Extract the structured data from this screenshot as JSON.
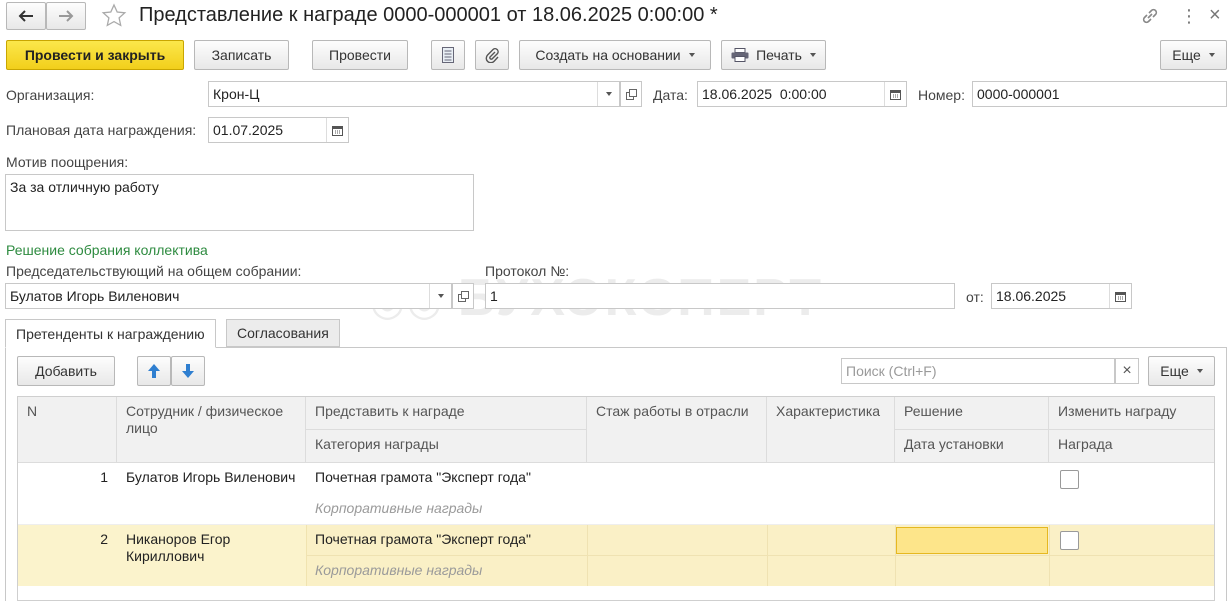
{
  "window": {
    "title": "Представление к награде 0000-000001 от 18.06.2025 0:00:00 *"
  },
  "toolbar": {
    "post_close": "Провести и закрыть",
    "save": "Записать",
    "post": "Провести",
    "create_based": "Создать на основании",
    "print": "Печать",
    "more": "Еще"
  },
  "form": {
    "organization_label": "Организация:",
    "organization_value": "Крон-Ц",
    "date_label": "Дата:",
    "date_value": "18.06.2025  0:00:00",
    "number_label": "Номер:",
    "number_value": "0000-000001",
    "planned_date_label": "Плановая дата награждения:",
    "planned_date_value": "01.07.2025",
    "motive_label": "Мотив поощрения:",
    "motive_value": "За за отличную работу",
    "decision_section": "Решение собрания коллектива",
    "chairman_label": "Председательствующий на общем собрании:",
    "chairman_value": "Булатов Игорь Виленович",
    "protocol_label": "Протокол №:",
    "protocol_value": "1",
    "from_label": "от:",
    "from_value": "18.06.2025"
  },
  "watermark": "БУХЭКСПЕРТ",
  "tabs": [
    {
      "label": "Претенденты к награждению",
      "active": true
    },
    {
      "label": "Согласования",
      "active": false
    }
  ],
  "table_toolbar": {
    "add": "Добавить",
    "search_placeholder": "Поиск (Ctrl+F)",
    "more": "Еще"
  },
  "table": {
    "headers": {
      "n": "N",
      "employee": "Сотрудник / физическое лицо",
      "award": "Представить к награде",
      "award_category": "Категория награды",
      "experience": "Стаж работы в отрасли",
      "characteristic": "Характеристика",
      "decision": "Решение",
      "set_date": "Дата установки",
      "change_award": "Изменить награду",
      "award_col": "Награда"
    },
    "rows": [
      {
        "n": "1",
        "employee": "Булатов Игорь Виленович",
        "award": "Почетная грамота \"Эксперт года\"",
        "category": "Корпоративные награды"
      },
      {
        "n": "2",
        "employee": "Никаноров Егор Кириллович",
        "award": "Почетная грамота \"Эксперт года\"",
        "category": "Корпоративные награды"
      }
    ]
  }
}
